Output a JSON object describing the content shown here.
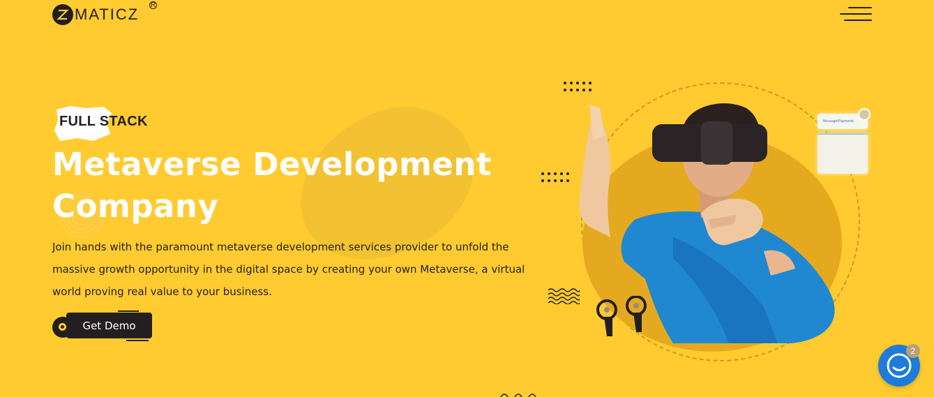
{
  "header": {
    "brand": "MATICZ",
    "registered_mark": "R",
    "menu_icon": "hamburger-menu-icon"
  },
  "hero": {
    "tag": "FULL STACK",
    "title": "Metaverse Development Company",
    "description": "Join hands with the paramount metaverse development services provider to unfold the massive growth opportunity in the digital space by creating your own Metaverse, a virtual world proving real value to your business.",
    "cta_label": "Get Demo"
  },
  "illustration": {
    "chat_card_title": "Message/Payments"
  },
  "chat_widget": {
    "icon": "chat-bubble-icon",
    "badge_count": "2"
  },
  "colors": {
    "background": "#ffcb30",
    "dark": "#231f20",
    "accent_blue": "#1e7bd9",
    "title_white": "#ffffff"
  }
}
